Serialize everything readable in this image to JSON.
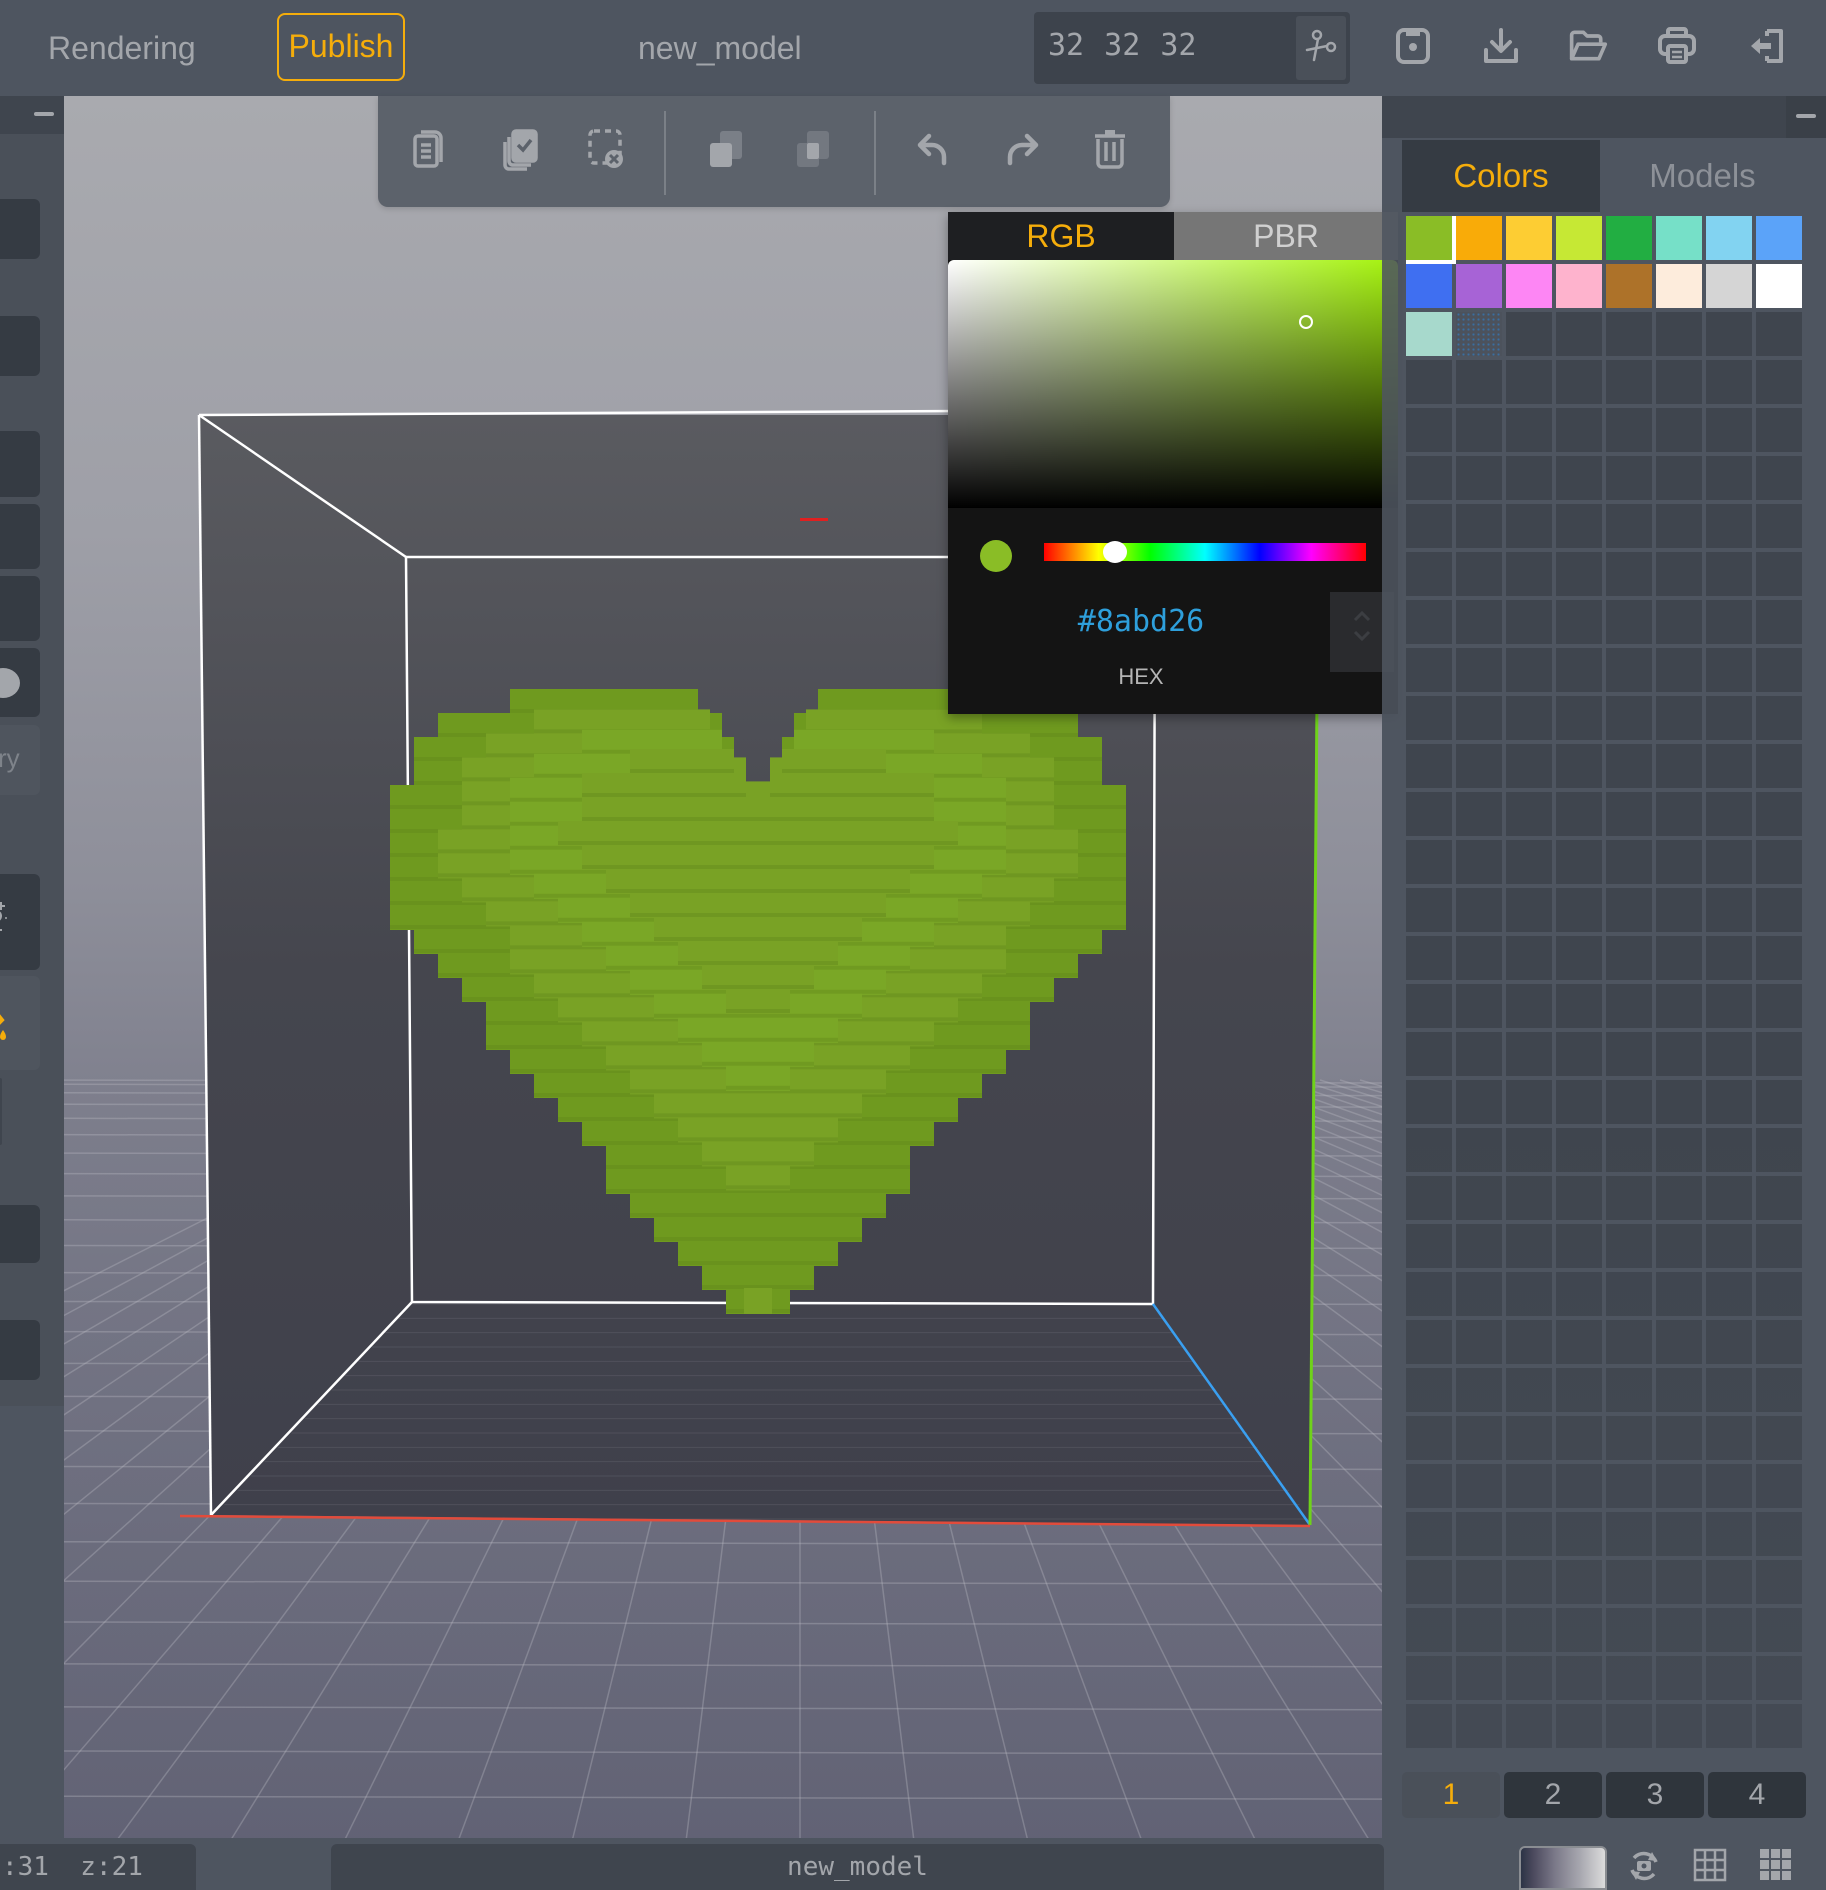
{
  "topbar": {
    "rendering_label": "Rendering",
    "publish_label": "Publish",
    "model_name": "new_model",
    "dimensions": "32  32  32",
    "icons": [
      "scissors-icon",
      "save-icon",
      "download-icon",
      "open-folder-icon",
      "print-icon",
      "exit-icon"
    ]
  },
  "toolbar": {
    "buttons": [
      "copy-icon",
      "select-all-icon",
      "deselect-icon",
      "duplicate-icon",
      "intersect-icon",
      "undo-icon",
      "redo-icon",
      "delete-icon"
    ]
  },
  "left_panel": {
    "partial_label": "ry"
  },
  "color_picker": {
    "tabs": [
      "RGB",
      "PBR"
    ],
    "active_tab": "RGB",
    "hex_value": "#8abd26",
    "hex_label": "HEX",
    "hue_position": 0.22,
    "saturation": 0.8,
    "brightness": 0.74,
    "current_color": "#8abd26"
  },
  "right_panel": {
    "tabs": [
      "Colors",
      "Models"
    ],
    "active_tab": "Colors",
    "palette": [
      "#8abd26",
      "#f9ab08",
      "#fdcd33",
      "#c6e834",
      "#22ae42",
      "#76e0c8",
      "#82d3f1",
      "#5ba3f9",
      "#3f6ff1",
      "#a763d6",
      "#fd86f4",
      "#feb3cd",
      "#ad7229",
      "#fdecdc",
      "#d5d5d5",
      "#ffffff",
      "#a7d9cc"
    ],
    "selected_index": 0,
    "page_tabs": [
      "1",
      "2",
      "3",
      "4"
    ],
    "active_page": "1"
  },
  "statusbar": {
    "coords": ":31  z:21",
    "model_name": "new_model"
  },
  "scene": {
    "model_color": "#79a225",
    "axis_colors": {
      "x": "#e24b3b",
      "y": "#6fd21a",
      "z": "#3a9ff0"
    }
  },
  "colors": {
    "accent": "#f5ad0b",
    "hex_text": "#2e9fdb"
  }
}
